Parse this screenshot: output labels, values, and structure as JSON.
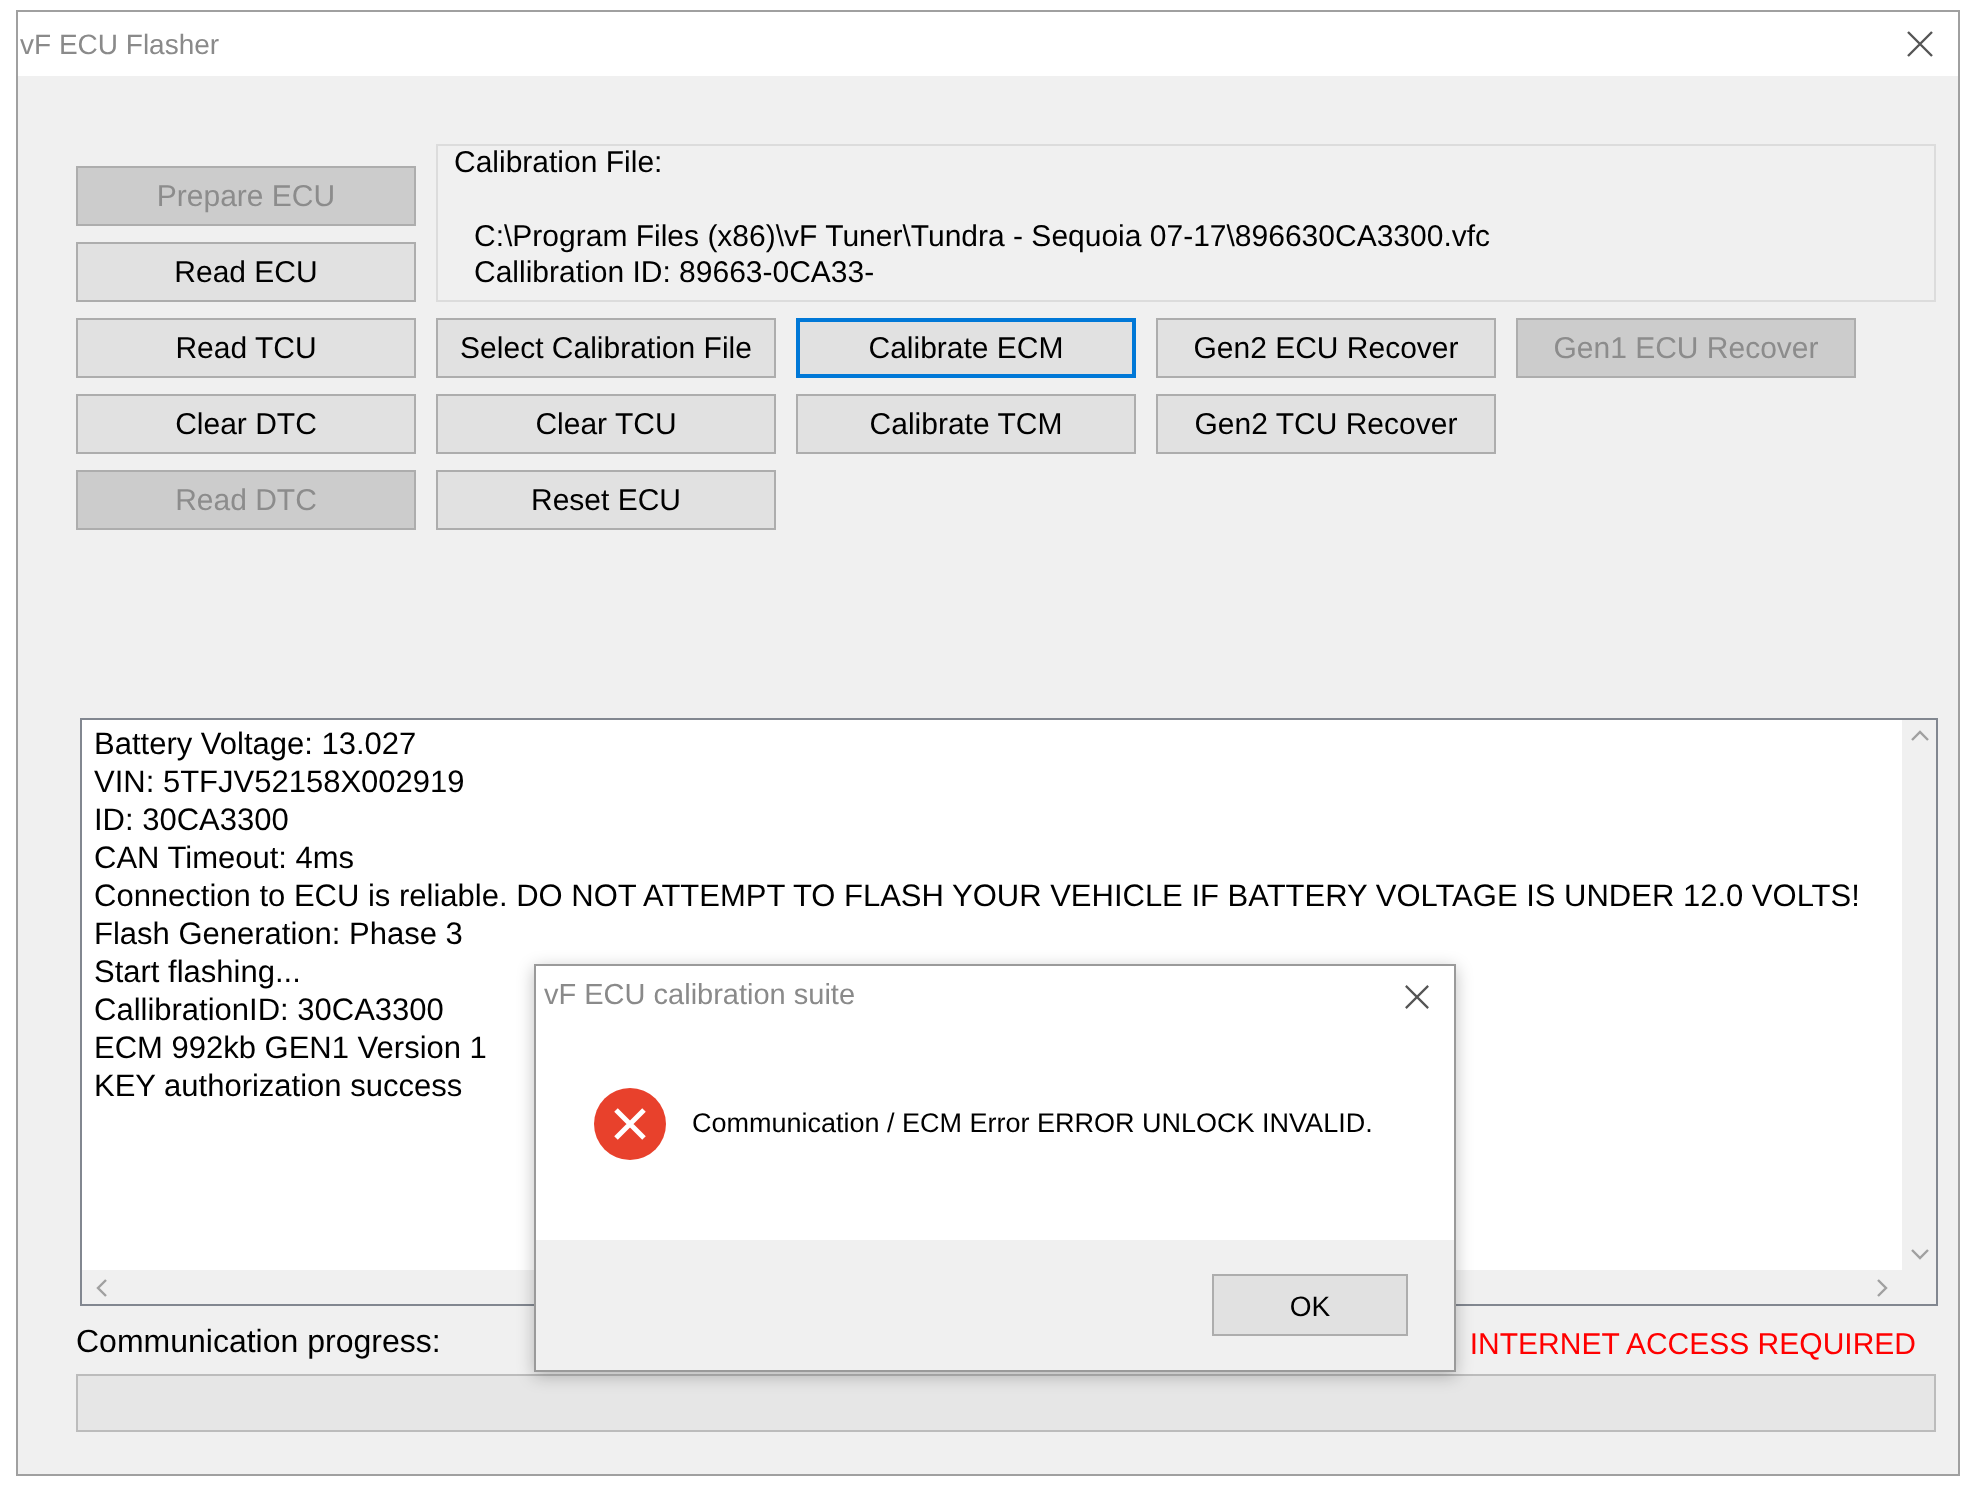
{
  "window": {
    "title": "vF ECU Flasher"
  },
  "button_rows": [
    [
      {
        "label": "Prepare ECU",
        "disabled": true,
        "focused": false
      }
    ],
    [
      {
        "label": "Read ECU",
        "disabled": false,
        "focused": false
      }
    ],
    [
      {
        "label": "Read TCU",
        "disabled": false,
        "focused": false
      },
      {
        "label": "Select Calibration File",
        "disabled": false,
        "focused": false
      },
      {
        "label": "Calibrate ECM",
        "disabled": false,
        "focused": true
      },
      {
        "label": "Gen2 ECU Recover",
        "disabled": false,
        "focused": false
      },
      {
        "label": "Gen1 ECU Recover",
        "disabled": true,
        "focused": false
      }
    ],
    [
      {
        "label": "Clear DTC",
        "disabled": false,
        "focused": false
      },
      {
        "label": "Clear TCU",
        "disabled": false,
        "focused": false
      },
      {
        "label": "Calibrate TCM",
        "disabled": false,
        "focused": false
      },
      {
        "label": "Gen2 TCU Recover",
        "disabled": false,
        "focused": false
      }
    ],
    [
      {
        "label": "Read DTC",
        "disabled": true,
        "focused": false
      },
      {
        "label": "Reset ECU",
        "disabled": false,
        "focused": false
      }
    ]
  ],
  "calibration": {
    "label": "Calibration File:",
    "path": "C:\\Program Files (x86)\\vF Tuner\\Tundra - Sequoia 07-17\\896630CA3300.vfc",
    "id": "Callibration ID: 89663-0CA33-"
  },
  "log": [
    "Battery Voltage: 13.027",
    "VIN: 5TFJV52158X002919",
    "ID: 30CA3300",
    "CAN Timeout: 4ms",
    "Connection to ECU is reliable. DO NOT ATTEMPT TO FLASH YOUR VEHICLE IF BATTERY VOLTAGE IS UNDER 12.0 VOLTS!",
    "Flash Generation: Phase 3",
    "Start flashing...",
    "CallibrationID: 30CA3300",
    "ECM 992kb GEN1 Version 1",
    "KEY authorization success"
  ],
  "progress": {
    "label": "Communication progress:",
    "notice": "INTERNET ACCESS REQUIRED",
    "level": 0
  },
  "dialog": {
    "title": "vF ECU calibration suite",
    "message": "Communication / ECM Error ERROR UNLOCK INVALID.",
    "button": "OK"
  }
}
